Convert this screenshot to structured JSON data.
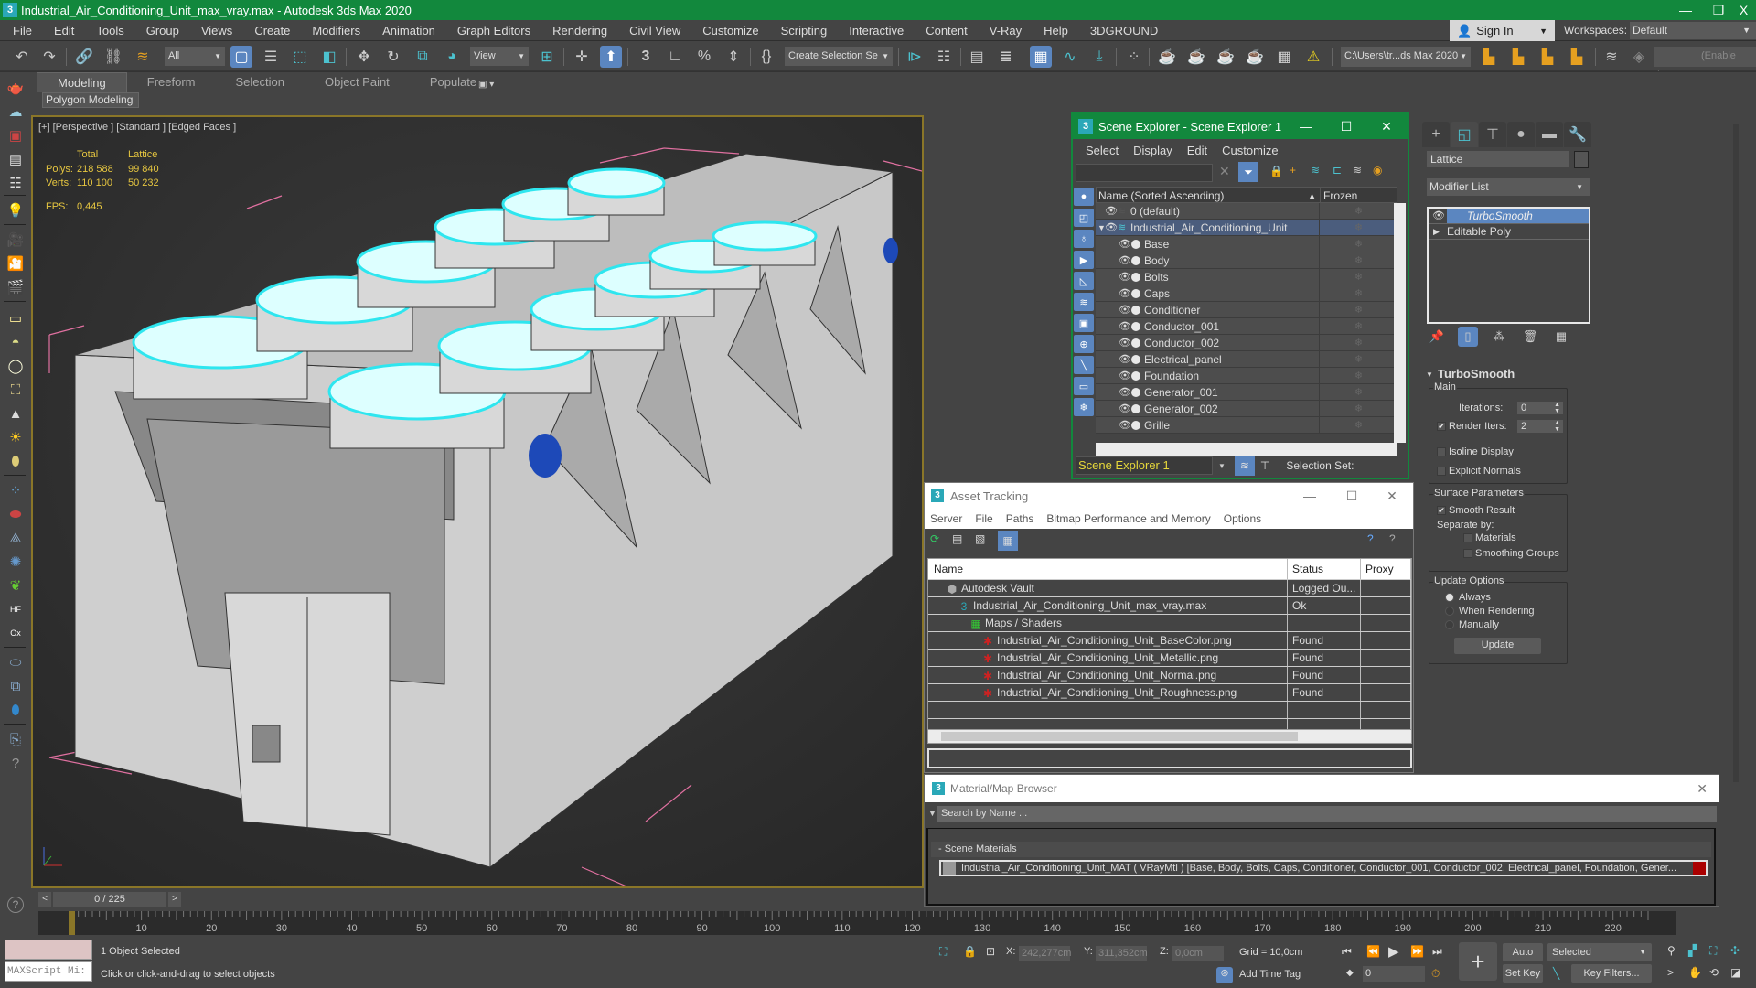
{
  "titlebar": {
    "title": "Industrial_Air_Conditioning_Unit_max_vray.max - Autodesk 3ds Max 2020",
    "icon": "3",
    "minimize": "—",
    "restore": "❐",
    "close": "X"
  },
  "menubar": {
    "items": [
      "File",
      "Edit",
      "Tools",
      "Group",
      "Views",
      "Create",
      "Modifiers",
      "Animation",
      "Graph Editors",
      "Rendering",
      "Civil View",
      "Customize",
      "Scripting",
      "Interactive",
      "Content",
      "V-Ray",
      "Help",
      "3DGROUND"
    ],
    "sign_in": "Sign In",
    "workspaces_label": "Workspaces:",
    "workspace_value": "Default"
  },
  "maintoolbar": {
    "selection_filter": "All",
    "reference_coord": "View",
    "named_selection": "Create Selection Se",
    "project_path": "C:\\Users\\tr...ds Max 2020",
    "layer_field": "(Enable Laye"
  },
  "ribbon": {
    "tabs": [
      "Modeling",
      "Freeform",
      "Selection",
      "Object Paint",
      "Populate"
    ],
    "active_tab": "Modeling",
    "panel_label": "Polygon Modeling"
  },
  "viewport": {
    "label": "[+] [Perspective ] [Standard ] [Edged Faces ]",
    "stats": {
      "col_total": "Total",
      "col_selected": "Lattice",
      "polys_label": "Polys:",
      "polys_total": "218 588",
      "polys_selected": "99 840",
      "verts_label": "Verts:",
      "verts_total": "110 100",
      "verts_selected": "50 232",
      "fps_label": "FPS:",
      "fps_value": "0,445"
    }
  },
  "scene_explorer": {
    "title": "Scene Explorer - Scene Explorer 1",
    "menu": [
      "Select",
      "Display",
      "Edit",
      "Customize"
    ],
    "col_name": "Name (Sorted Ascending)",
    "col_frozen": "Frozen",
    "rows": [
      {
        "name": "0 (default)",
        "type": "layer",
        "selected": false
      },
      {
        "name": "Industrial_Air_Conditioning_Unit",
        "type": "layer",
        "selected": true
      },
      {
        "name": "Base",
        "type": "object"
      },
      {
        "name": "Body",
        "type": "object"
      },
      {
        "name": "Bolts",
        "type": "object"
      },
      {
        "name": "Caps",
        "type": "object"
      },
      {
        "name": "Conditioner",
        "type": "object"
      },
      {
        "name": "Conductor_001",
        "type": "object"
      },
      {
        "name": "Conductor_002",
        "type": "object"
      },
      {
        "name": "Electrical_panel",
        "type": "object"
      },
      {
        "name": "Foundation",
        "type": "object"
      },
      {
        "name": "Generator_001",
        "type": "object"
      },
      {
        "name": "Generator_002",
        "type": "object"
      },
      {
        "name": "Grille",
        "type": "object"
      }
    ],
    "explorer_name": "Scene Explorer 1",
    "selection_set_label": "Selection Set:"
  },
  "command_panel": {
    "object_name": "Lattice",
    "modifier_list": "Modifier List",
    "stack": [
      {
        "name": "TurboSmooth",
        "selected": true
      },
      {
        "name": "Editable Poly",
        "selected": false
      }
    ],
    "rollout_title": "TurboSmooth",
    "main_group": "Main",
    "iterations_label": "Iterations:",
    "iterations_value": "0",
    "render_iters_label": "Render Iters:",
    "render_iters_value": "2",
    "render_iters_checked": true,
    "isoline_label": "Isoline Display",
    "isoline_checked": false,
    "explicit_normals_label": "Explicit Normals",
    "explicit_normals_checked": false,
    "surface_group": "Surface Parameters",
    "smooth_result_label": "Smooth Result",
    "smooth_result_checked": true,
    "separate_by_label": "Separate by:",
    "materials_label": "Materials",
    "smoothing_groups_label": "Smoothing Groups",
    "update_group": "Update Options",
    "update_options": [
      "Always",
      "When Rendering",
      "Manually"
    ],
    "update_selected": "Always",
    "update_button": "Update"
  },
  "asset_tracking": {
    "title": "Asset Tracking",
    "menu": [
      "Server",
      "File",
      "Paths",
      "Bitmap Performance and Memory",
      "Options"
    ],
    "columns": [
      "Name",
      "Status",
      "Proxy"
    ],
    "rows": [
      {
        "name": "Autodesk Vault",
        "status": "Logged Ou...",
        "indent": 1,
        "icon": "vault"
      },
      {
        "name": "Industrial_Air_Conditioning_Unit_max_vray.max",
        "status": "Ok",
        "indent": 2,
        "icon": "max"
      },
      {
        "name": "Maps / Shaders",
        "status": "",
        "indent": 3,
        "icon": "maps"
      },
      {
        "name": "Industrial_Air_Conditioning_Unit_BaseColor.png",
        "status": "Found",
        "indent": 4,
        "icon": "bitmap"
      },
      {
        "name": "Industrial_Air_Conditioning_Unit_Metallic.png",
        "status": "Found",
        "indent": 4,
        "icon": "bitmap"
      },
      {
        "name": "Industrial_Air_Conditioning_Unit_Normal.png",
        "status": "Found",
        "indent": 4,
        "icon": "bitmap"
      },
      {
        "name": "Industrial_Air_Conditioning_Unit_Roughness.png",
        "status": "Found",
        "indent": 4,
        "icon": "bitmap"
      }
    ]
  },
  "material_browser": {
    "title": "Material/Map Browser",
    "search_placeholder": "Search by Name ...",
    "section": "- Scene Materials",
    "material": "Industrial_Air_Conditioning_Unit_MAT ( VRayMtl ) [Base, Body, Bolts, Caps, Conditioner, Conductor_001, Conductor_002, Electrical_panel, Foundation, Gener..."
  },
  "timeline": {
    "frame_display": "0 / 225",
    "current_frame": 0,
    "total_frames": 225,
    "ticks": [
      "0",
      "10",
      "20",
      "30",
      "40",
      "50",
      "60",
      "70",
      "80",
      "90",
      "100",
      "110",
      "120",
      "130",
      "140",
      "150",
      "160",
      "170",
      "180",
      "190",
      "200",
      "210",
      "220"
    ]
  },
  "statusbar": {
    "maxscript_placeholder": "MAXScript Mi:",
    "selection_status": "1 Object Selected",
    "prompt": "Click or click-and-drag to select objects",
    "x_label": "X:",
    "x_value": "242,277cm",
    "y_label": "Y:",
    "y_value": "311,352cm",
    "z_label": "Z:",
    "z_value": "0,0cm",
    "grid": "Grid = 10,0cm",
    "add_time_tag": "Add Time Tag",
    "frame_value": "0",
    "auto_key": "Auto Key",
    "set_key": "Set Key",
    "key_mode": "Selected",
    "key_filters": "Key Filters..."
  }
}
